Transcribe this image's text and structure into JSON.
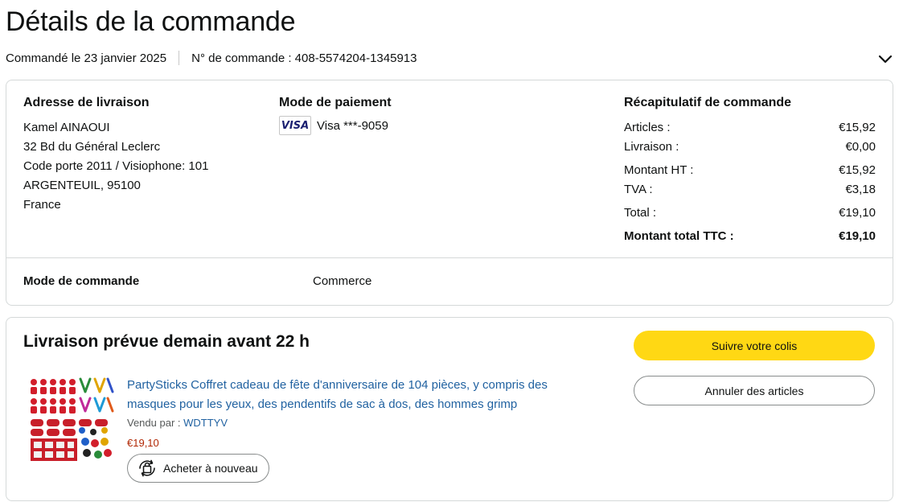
{
  "page": {
    "title": "Détails de la commande"
  },
  "order_meta": {
    "date_text": "Commandé le 23 janvier 2025",
    "number_text": "N° de commande : 408-5574204-1345913",
    "expand_icon": "chevron-down-icon"
  },
  "shipping": {
    "heading": "Adresse de livraison",
    "lines": [
      "Kamel AINAOUI",
      "32 Bd du Général Leclerc",
      "Code porte 2011 / Visiophone: 101",
      "ARGENTEUIL, 95100",
      "France"
    ]
  },
  "payment": {
    "heading": "Mode de paiement",
    "card_logo": "VISA",
    "card_text": "Visa ***-9059"
  },
  "summary": {
    "heading": "Récapitulatif de commande",
    "rows": [
      {
        "label": "Articles :",
        "value": "€15,92"
      },
      {
        "label": "Livraison :",
        "value": "€0,00"
      },
      {
        "label": "Montant HT :",
        "value": "€15,92"
      },
      {
        "label": "TVA :",
        "value": "€3,18"
      },
      {
        "label": "Total :",
        "value": "€19,10"
      },
      {
        "label": "Montant total TTC :",
        "value": "€19,10"
      }
    ]
  },
  "order_mode": {
    "label": "Mode de commande",
    "value": "Commerce"
  },
  "delivery": {
    "title": "Livraison prévue demain avant 22 h",
    "track_button": "Suivre votre colis",
    "cancel_button": "Annuler des articles"
  },
  "product": {
    "title": "PartySticks Coffret cadeau de fête d'anniversaire de 104 pièces, y compris des masques pour les yeux, des pendentifs de sac à dos, des hommes grimp",
    "sold_by_label": "Vendu par : ",
    "seller": "WDTTYV",
    "price": "€19,10",
    "rebuy_button": "Acheter à nouveau",
    "rebuy_icon": "rebuy-bag-icon"
  },
  "colors": {
    "accent_button": "#ffd814",
    "link": "#2162a1",
    "price": "#b12704",
    "border": "#d5d9d9"
  }
}
